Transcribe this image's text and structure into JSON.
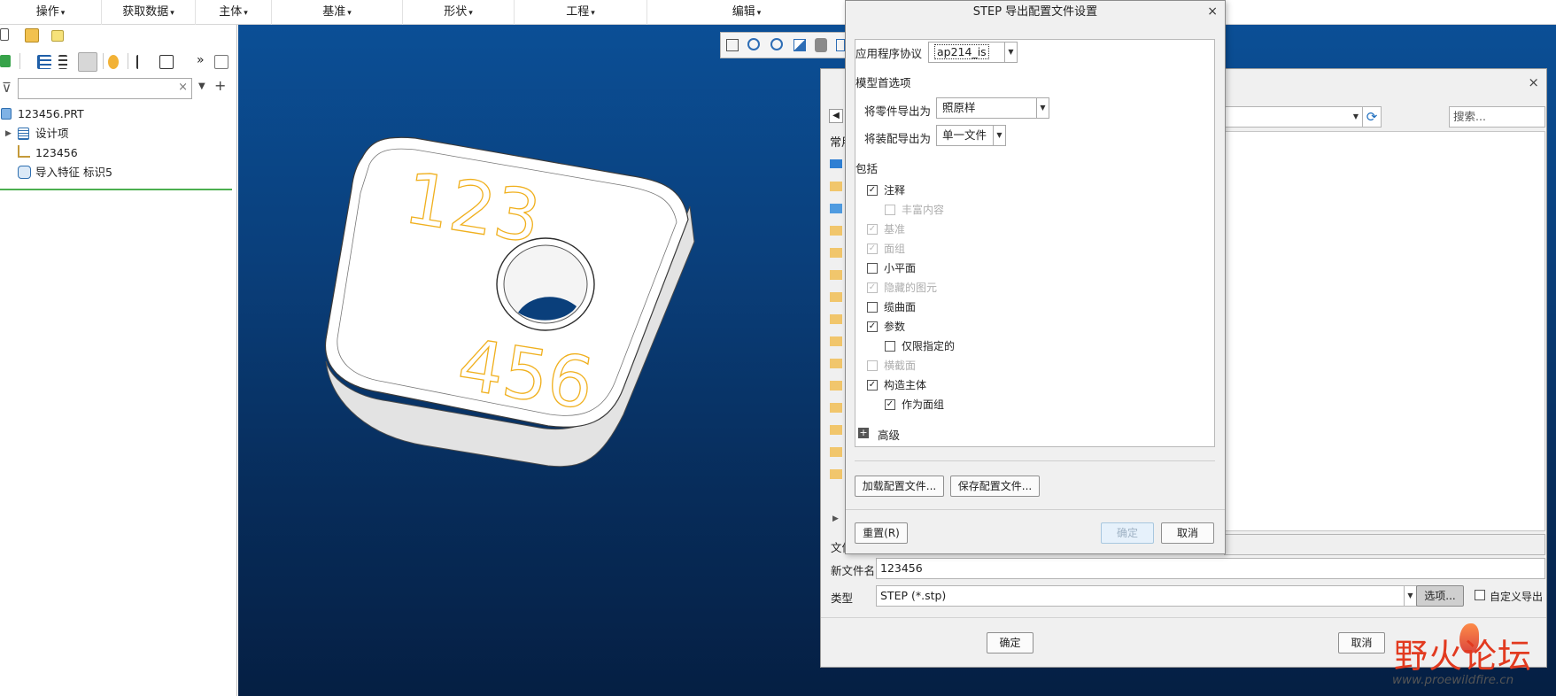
{
  "ribbon": {
    "menus": [
      "操作",
      "获取数据",
      "主体",
      "基准",
      "形状",
      "工程",
      "编辑"
    ]
  },
  "model_tree": {
    "filter_value": "",
    "items": [
      {
        "label": "123456.PRT",
        "icon": "part-icon"
      },
      {
        "label": "设计项",
        "icon": "design-items-icon"
      },
      {
        "label": "123456",
        "icon": "csys-icon"
      },
      {
        "label": "导入特征 标识5",
        "icon": "import-feature-icon"
      }
    ]
  },
  "model": {
    "text_top": "123",
    "text_bottom": "456",
    "engrave_color": "#f0b01e"
  },
  "save_dialog": {
    "close_glyph": "×",
    "search_placeholder": "搜索...",
    "sidebar_header": "常用",
    "file_name_label": "文件",
    "new_file_name_label": "新文件名",
    "new_file_name_value": "123456",
    "type_label": "类型",
    "type_value": "STEP (*.stp)",
    "options_button": "选项...",
    "custom_export_label": "自定义导出",
    "ok_button": "确定",
    "cancel_button": "取消"
  },
  "step_dialog": {
    "title": "STEP 导出配置文件设置",
    "close_glyph": "×",
    "protocol_label": "应用程序协议",
    "protocol_value": "ap214_is",
    "model_prefs_header": "模型首选项",
    "export_part_label": "将零件导出为",
    "export_part_value": "照原样",
    "export_asm_label": "将装配导出为",
    "export_asm_value": "单一文件",
    "include_header": "包括",
    "options": [
      {
        "label": "注释",
        "checked": true,
        "disabled": false,
        "indent": 0
      },
      {
        "label": "丰富内容",
        "checked": false,
        "disabled": true,
        "indent": 1
      },
      {
        "label": "基准",
        "checked": true,
        "disabled": true,
        "indent": 0
      },
      {
        "label": "面组",
        "checked": true,
        "disabled": true,
        "indent": 0
      },
      {
        "label": "小平面",
        "checked": false,
        "disabled": false,
        "indent": 0
      },
      {
        "label": "隐藏的图元",
        "checked": true,
        "disabled": true,
        "indent": 0
      },
      {
        "label": "缆曲面",
        "checked": false,
        "disabled": false,
        "indent": 0
      },
      {
        "label": "参数",
        "checked": true,
        "disabled": false,
        "indent": 0
      },
      {
        "label": "仅限指定的",
        "checked": false,
        "disabled": false,
        "indent": 1
      },
      {
        "label": "横截面",
        "checked": false,
        "disabled": true,
        "indent": 0
      },
      {
        "label": "构造主体",
        "checked": true,
        "disabled": false,
        "indent": 0
      },
      {
        "label": "作为面组",
        "checked": true,
        "disabled": false,
        "indent": 1
      }
    ],
    "advanced_label": "高级",
    "load_config_button": "加载配置文件...",
    "save_config_button": "保存配置文件...",
    "reset_button": "重置(R)",
    "ok_button": "确定",
    "cancel_button": "取消"
  },
  "watermark": {
    "brand": "野火论坛",
    "url": "www.proewildfire.cn"
  }
}
